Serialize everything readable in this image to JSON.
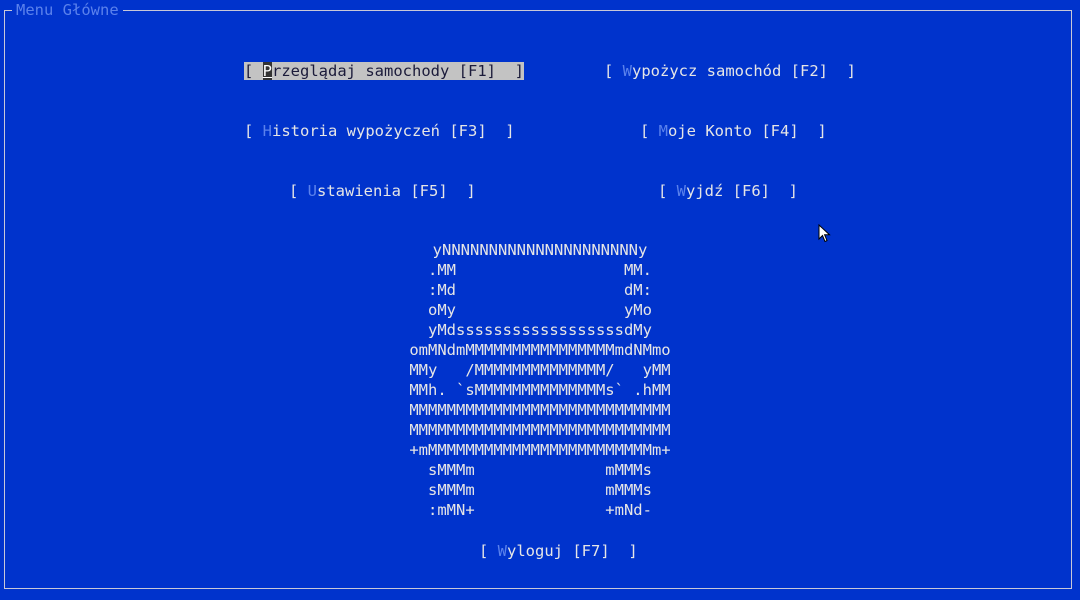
{
  "window": {
    "title": "Menu Główne"
  },
  "buttons": {
    "browse": {
      "open": "[ ",
      "hot": "P",
      "rest": "rzeglądaj samochody [F1]  ]"
    },
    "rent": {
      "open": "[ ",
      "hot": "W",
      "rest": "ypożycz samochód [F2]  ]"
    },
    "history": {
      "open": "[ ",
      "hot": "H",
      "rest": "istoria wypożyczeń [F3]  ]"
    },
    "account": {
      "open": "[ ",
      "hot": "M",
      "rest": "oje Konto [F4]  ]"
    },
    "settings": {
      "open": "[ ",
      "hot": "U",
      "rest": "stawienia [F5]  ]"
    },
    "exit": {
      "open": "[ ",
      "hot": "W",
      "rest": "yjdź [F6]  ]"
    },
    "logout": {
      "open": "[ ",
      "hot": "W",
      "rest": "yloguj [F7]  ]"
    }
  },
  "logo": {
    "lines": [
      "  yNNNNNNNNNNNNNNNNNNNNNy  ",
      " .MM                  MM. ",
      " :Md                  dM: ",
      " oMy                  yMo ",
      " yMdssssssssssssssssssdMy ",
      "omMNdmMMMMMMMMMMMMMMMMmdNMmo",
      "MMy   /MMMMMMMMMMMMMM/   yMM",
      "MMh. `sMMMMMMMMMMMMMMs` .hMM",
      "MMMMMMMMMMMMMMMMMMMMMMMMMMMM",
      "MMMMMMMMMMMMMMMMMMMMMMMMMMMM",
      "+mMMMMMMMMMMMMMMMMMMMMMMMMm+",
      "  sMMMm              mMMMs  ",
      "  sMMMm              mMMMs  ",
      "  :mMN+              +mNd-  "
    ]
  },
  "colors": {
    "background": "#0033cc",
    "hotkey": "#5b82ec",
    "text": "#e6e6e6",
    "focused_bg": "#c3c3c3"
  }
}
